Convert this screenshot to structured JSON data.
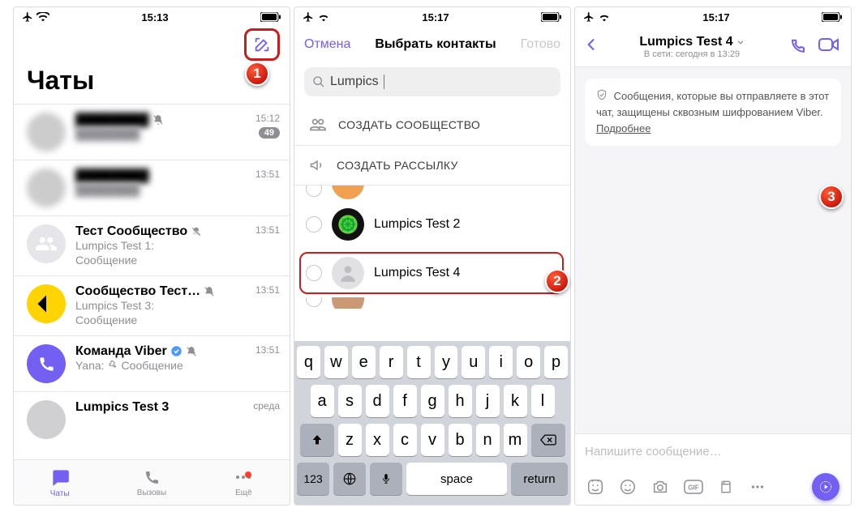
{
  "screen1": {
    "status_time": "15:13",
    "title": "Чаты",
    "chats": [
      {
        "name": "████████",
        "sub": "████████",
        "time": "15:12",
        "badge": "49",
        "blurred": true,
        "muted": true
      },
      {
        "name": "████████",
        "sub": "████████",
        "time": "13:51",
        "blurred": true
      },
      {
        "name": "Тест Сообщество",
        "sub1": "Lumpics Test 1:",
        "sub2": "Сообщение",
        "time": "13:51",
        "muted": true,
        "avatar": "group-grey"
      },
      {
        "name": "Сообщество Тест…",
        "sub1": "Lumpics Test 3:",
        "sub2": "Сообщение",
        "time": "13:51",
        "muted": true,
        "avatar": "yellow"
      },
      {
        "name": "Команда Viber",
        "sub_prefix": "Yana:",
        "sub_icon": "pin",
        "sub_text": "Сообщение",
        "time": "13:51",
        "muted": true,
        "verified": true,
        "avatar": "viber"
      },
      {
        "name": "Lumpics Test 3",
        "time": "среда",
        "avatar": "half"
      }
    ],
    "tabs": {
      "chats": "Чаты",
      "calls": "Вызовы",
      "more": "Ещё"
    }
  },
  "screen2": {
    "status_time": "15:17",
    "cancel": "Отмена",
    "title": "Выбрать контакты",
    "done": "Готово",
    "search_value": "Lumpics",
    "action_community": "СОЗДАТЬ СООБЩЕСТВО",
    "action_broadcast": "СОЗДАТЬ РАССЫЛКУ",
    "contacts": [
      {
        "name": "Lumpics Test 2",
        "avatar": "lime"
      },
      {
        "name": "Lumpics Test 4",
        "avatar": "person",
        "highlighted": true
      }
    ],
    "kb_rows": [
      [
        "q",
        "w",
        "e",
        "r",
        "t",
        "y",
        "u",
        "i",
        "o",
        "p"
      ],
      [
        "a",
        "s",
        "d",
        "f",
        "g",
        "h",
        "j",
        "k",
        "l"
      ],
      [
        "z",
        "x",
        "c",
        "v",
        "b",
        "n",
        "m"
      ]
    ],
    "kb_space": "space",
    "kb_return": "return",
    "kb_123": "123"
  },
  "screen3": {
    "status_time": "15:17",
    "title": "Lumpics Test 4",
    "subtitle": "В сети: сегодня в 13:29",
    "sysmsg": "Сообщения, которые вы отправляете в этот чат, защищены сквозным шифрованием Viber.",
    "sysmsg_link": "Подробнее",
    "composer_placeholder": "Напишите сообщение…"
  },
  "steps": {
    "s1": "1",
    "s2": "2",
    "s3": "3"
  }
}
